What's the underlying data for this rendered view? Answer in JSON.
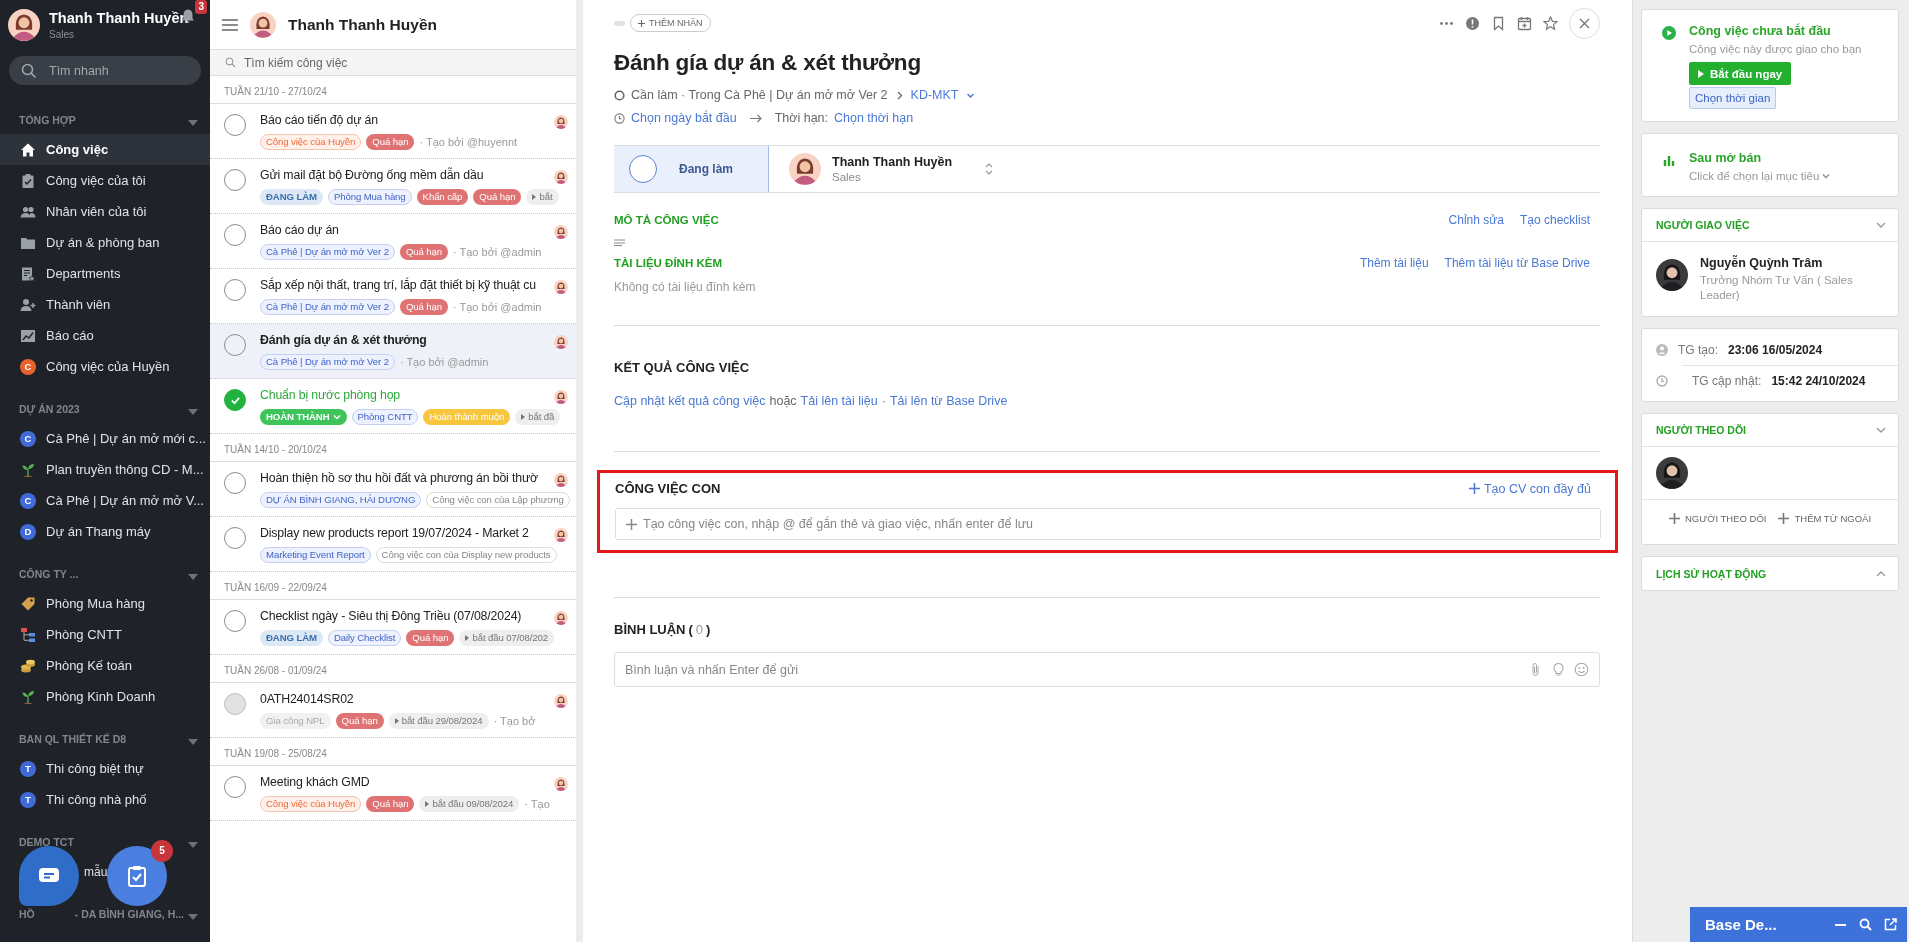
{
  "sidebar": {
    "user": {
      "name": "Thanh Thanh Huyền",
      "role": "Sales",
      "notifications": "3"
    },
    "search": {
      "placeholder": "Tìm nhanh"
    },
    "sections": [
      {
        "title": "TỔNG HỢP",
        "items": [
          {
            "label": "Công việc",
            "kind": "home",
            "selected": true
          },
          {
            "label": "Công việc của tôi",
            "kind": "clipboard",
            "selected": false
          },
          {
            "label": "Nhân viên của tôi",
            "kind": "people",
            "selected": false
          },
          {
            "label": "Dự án & phòng ban",
            "kind": "folder",
            "selected": false
          },
          {
            "label": "Departments",
            "kind": "dept",
            "selected": false
          },
          {
            "label": "Thành viên",
            "kind": "member",
            "selected": false
          },
          {
            "label": "Báo cáo",
            "kind": "chart",
            "selected": false
          },
          {
            "label": "Công việc của Huyền",
            "kind": "letter",
            "letter": "C",
            "color": "#e8622c",
            "selected": false
          }
        ]
      },
      {
        "title": "DỰ ÁN 2023",
        "items": [
          {
            "label": "Cà Phê | Dự án mở mới c...",
            "kind": "letter",
            "letter": "C",
            "color": "#3f6ad8",
            "selected": false
          },
          {
            "label": "Plan truyền thông CD - M...",
            "kind": "plant",
            "selected": false
          },
          {
            "label": "Cà Phê | Dự án mở mở V...",
            "kind": "letter",
            "letter": "C",
            "color": "#3f6ad8",
            "selected": false
          },
          {
            "label": "Dự án Thang máy",
            "kind": "letter",
            "letter": "D",
            "color": "#3f6ad8",
            "selected": false
          }
        ]
      },
      {
        "title": "CÔNG TY ...",
        "items": [
          {
            "label": "Phòng Mua hàng",
            "kind": "tag",
            "selected": false
          },
          {
            "label": "Phòng CNTT",
            "kind": "org",
            "selected": false
          },
          {
            "label": "Phòng Kế toán",
            "kind": "coins",
            "selected": false
          },
          {
            "label": "Phòng Kinh Doanh",
            "kind": "plant",
            "selected": false
          }
        ]
      },
      {
        "title": "BAN QL THIẾT KẾ D8",
        "items": [
          {
            "label": "Thi công biệt thự",
            "kind": "letter",
            "letter": "T",
            "color": "#3f6ad8",
            "selected": false
          },
          {
            "label": "Thi công nhà phố",
            "kind": "letter",
            "letter": "T",
            "color": "#3f6ad8",
            "selected": false
          }
        ]
      },
      {
        "title": "DEMO TCT",
        "items": [
          {
            "label": "mẫu",
            "kind": "covered",
            "selected": false
          }
        ]
      },
      {
        "title": "HỒ",
        "title_after": "- DA BÌNH GIANG, H..."
      }
    ],
    "floating": {
      "tasks_badge": "5"
    }
  },
  "task_list": {
    "owner": "Thanh Thanh Huyền",
    "search": {
      "placeholder": "Tìm kiếm công việc"
    },
    "groups": [
      {
        "week": "TUẦN 21/10 - 27/10/24",
        "tasks": [
          {
            "title": "Báo cáo tiến độ dự án",
            "done": false,
            "disabled": false,
            "selected": false,
            "tags": [
              {
                "kind": "personal",
                "text": "Công việc của Huyền"
              },
              {
                "kind": "overdue",
                "text": "Quá hạn"
              }
            ],
            "creator": "· Tạo bởi @huyennt"
          },
          {
            "title": "Gửi mail đặt bộ Đường ống mềm dẫn dầu",
            "done": false,
            "disabled": false,
            "selected": false,
            "tags": [
              {
                "kind": "status",
                "text": "ĐANG LÀM"
              },
              {
                "kind": "project",
                "text": "Phòng Mua hàng"
              },
              {
                "kind": "overdue",
                "text": "Khẩn cấp"
              },
              {
                "kind": "overdue",
                "text": "Quá hạn"
              },
              {
                "kind": "start",
                "text": "bắt"
              }
            ]
          },
          {
            "title": "Báo cáo dự án",
            "done": false,
            "disabled": false,
            "selected": false,
            "tags": [
              {
                "kind": "project",
                "text": "Cà Phê | Dự án mở mở Ver 2"
              },
              {
                "kind": "overdue",
                "text": "Quá hạn"
              }
            ],
            "creator": "· Tạo bởi @admin"
          },
          {
            "title": "Sắp xếp nội thất, trang trí, lắp đặt thiết bị kỹ thuật cu",
            "done": false,
            "disabled": false,
            "selected": false,
            "tags": [
              {
                "kind": "project",
                "text": "Cà Phê | Dự án mở mở Ver 2"
              },
              {
                "kind": "overdue",
                "text": "Quá hạn"
              }
            ],
            "creator": "· Tạo bởi @admin"
          },
          {
            "title": "Đánh gía dự án & xét thưởng",
            "done": false,
            "disabled": false,
            "selected": true,
            "tags": [
              {
                "kind": "project",
                "text": "Cà Phê | Dự án mở mở Ver 2"
              }
            ],
            "creator": "· Tạo bởi @admin"
          },
          {
            "title": "Chuẩn bị nước phòng họp",
            "done": true,
            "disabled": false,
            "selected": false,
            "tags": [
              {
                "kind": "done",
                "text": "HOÀN THÀNH"
              },
              {
                "kind": "project",
                "text": "Phòng CNTT"
              },
              {
                "kind": "late",
                "text": "Hoàn thành muộn"
              },
              {
                "kind": "start",
                "text": "bắt đầ"
              }
            ]
          }
        ]
      },
      {
        "week": "TUẦN 14/10 - 20/10/24",
        "tasks": [
          {
            "title": "Hoàn thiện hồ sơ thu hồi đất và phương án bồi thườ",
            "done": false,
            "disabled": false,
            "selected": false,
            "tags": [
              {
                "kind": "project",
                "text": "DỰ ÁN BÌNH GIANG, HẢI DƯƠNG"
              },
              {
                "kind": "sub",
                "text": "Công việc con của Lập phương"
              }
            ]
          },
          {
            "title": "Display new products report 19/07/2024 - Market 2",
            "done": false,
            "disabled": false,
            "selected": false,
            "tags": [
              {
                "kind": "project",
                "text": "Marketing Event Report"
              },
              {
                "kind": "sub",
                "text": "Công việc con của Display new products"
              }
            ]
          }
        ]
      },
      {
        "week": "TUẦN 16/09 - 22/09/24",
        "tasks": [
          {
            "title": "Checklist ngày - Siêu thị Đông Triều (07/08/2024)",
            "done": false,
            "disabled": false,
            "selected": false,
            "tags": [
              {
                "kind": "status",
                "text": "ĐANG LÀM"
              },
              {
                "kind": "project",
                "text": "Daily Checklist"
              },
              {
                "kind": "overdue",
                "text": "Quá hạn"
              },
              {
                "kind": "start",
                "text": "bắt đầu 07/08/202"
              }
            ]
          }
        ]
      },
      {
        "week": "TUẦN 26/08 - 01/09/24",
        "tasks": [
          {
            "title": "0ATH24014SR02",
            "done": false,
            "disabled": true,
            "selected": false,
            "tags": [
              {
                "kind": "muted",
                "text": "Gia công NPL"
              },
              {
                "kind": "overdue",
                "text": "Quá hạn"
              },
              {
                "kind": "start",
                "text": "bắt đầu 29/08/2024"
              }
            ],
            "creator": "· Tạo bở"
          }
        ]
      },
      {
        "week": "TUẦN 19/08 - 25/08/24",
        "tasks": [
          {
            "title": "Meeting khách GMD",
            "done": false,
            "disabled": false,
            "selected": false,
            "tags": [
              {
                "kind": "personal",
                "text": "Công việc của Huyền"
              },
              {
                "kind": "overdue",
                "text": "Quá hạn"
              },
              {
                "kind": "start",
                "text": "bắt đầu 09/08/2024"
              }
            ],
            "creator": "· Tạo"
          }
        ]
      }
    ]
  },
  "detail": {
    "add_label": "THÊM NHÃN",
    "title": "Đánh gía dự án & xét thưởng",
    "breadcrumb": "Cần làm · Trong Cà Phê | Dự án mở mở Ver 2",
    "breadcrumb_link": "KD-MKT",
    "dates": [
      {
        "kind": "link",
        "text": "Chọn ngày bắt đầu"
      },
      {
        "kind": "arrow"
      },
      {
        "kind": "text",
        "text": "Thời hạn:"
      },
      {
        "kind": "link",
        "text": "Chọn thời hạn"
      }
    ],
    "status": "Đang làm",
    "assignee": {
      "name": "Thanh Thanh Huyền",
      "role": "Sales"
    },
    "description": {
      "title": "MÔ TẢ CÔNG VIỆC",
      "actions": [
        "Chỉnh sửa",
        "Tạo checklist"
      ]
    },
    "attachments": {
      "title": "TÀI LIỆU ĐÍNH KÈM",
      "actions": [
        "Thêm tài liệu",
        "Thêm tài liệu từ Base Drive"
      ],
      "empty": "Không có tài liệu đính kèm"
    },
    "result": {
      "title": "KẾT QUẢ CÔNG VIỆC",
      "actions": [
        {
          "kind": "link",
          "text": "Cập nhật kết quả công việc"
        },
        {
          "kind": "text",
          "text": "hoặc"
        },
        {
          "kind": "link",
          "text": "Tải lên tài liệu"
        },
        {
          "kind": "text",
          "text": "·"
        },
        {
          "kind": "link",
          "text": "Tải lên từ Base Drive"
        }
      ]
    },
    "subtasks": {
      "title": "CÔNG VIỆC CON",
      "action": "Tạo CV con đầy đủ",
      "placeholder": "Tạo công việc con, nhập @ để gắn thẻ và giao việc, nhấn enter để lưu",
      "highlighted": true
    },
    "comments": {
      "title": "BÌNH LUẬN",
      "count_open": "(",
      "count": "0",
      "count_close": ")",
      "placeholder": "Bình luận và nhấn Enter để gửi"
    }
  },
  "side_panel": {
    "start_card": {
      "title": "Công việc chưa bắt đầu",
      "note": "Công việc này được giao cho bạn",
      "start_button": "Bắt đầu ngay",
      "time_button": "Chọn thời gian"
    },
    "goal_card": {
      "title": "Sau mở bán",
      "note": "Click để chọn lại mục tiêu"
    },
    "assigner": {
      "title": "NGƯỜI GIAO VIỆC",
      "expanded": true,
      "name": "Nguyễn Quỳnh Trâm",
      "role": "Trưởng Nhóm Tư Vấn ( Sales Leader)"
    },
    "times": [
      {
        "kind": "created",
        "label": "TG tạo:",
        "value": "23:06 16/05/2024"
      },
      {
        "kind": "updated",
        "label": "TG cập nhật:",
        "value": "15:42 24/10/2024"
      }
    ],
    "followers": {
      "title": "NGƯỜI THEO DÕI",
      "expanded": true,
      "actions": [
        "NGƯỜI THEO DÕI",
        "THÊM TỪ NGOÀI"
      ]
    },
    "history": {
      "title": "LỊCH SỬ HOẠT ĐỘNG",
      "expanded": false
    }
  },
  "desk_widget": {
    "title": "Base De..."
  }
}
